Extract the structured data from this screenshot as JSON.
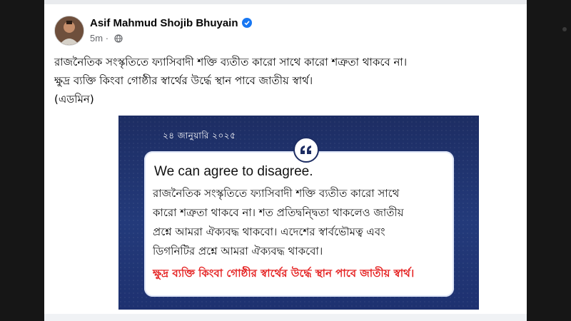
{
  "post": {
    "author": "Asif Mahmud Shojib Bhuyain",
    "verified": true,
    "time": "5m",
    "audience_icon": "globe-icon",
    "text_lines": [
      "রাজনৈতিক সংস্কৃতিতে ফ্যাসিবাদী শক্তি ব্যতীত কারো সাথে কারো শত্রুতা থাকবে না।",
      "ক্ষুদ্র ব্যক্তি কিংবা গোষ্ঠীর স্বার্থের উর্দ্ধে স্থান পাবে জাতীয় স্বার্থ।",
      "(এডমিন)"
    ]
  },
  "card": {
    "date": "২৪ জানুয়ারি ২০২৫",
    "title": "We can agree to disagree.",
    "body_lines": [
      "রাজনৈতিক সংস্কৃতিতে ফ্যাসিবাদী শক্তি ব্যতীত কারো সাথে",
      "কারো শত্রুতা থাকবে না। শত প্রতিদ্বন্দ্বিতা থাকলেও জাতীয়",
      "প্রশ্নে আমরা ঐক্যবদ্ধ থাকবো। এদেশের স্বার্বভৌমত্ব এবং",
      "ডিগনিটির প্রশ্নে আমরা ঐক্যবদ্ধ থাকবো।"
    ],
    "highlight": "ক্ষুদ্র ব্যক্তি কিংবা গোষ্ঠীর স্বার্থের উর্দ্ধে স্থান পাবে জাতীয় স্বার্থ।"
  },
  "colors": {
    "verified_blue": "#1877f2",
    "card_navy": "#1d2d63",
    "highlight_red": "#e52222",
    "meta_gray": "#65676b"
  }
}
